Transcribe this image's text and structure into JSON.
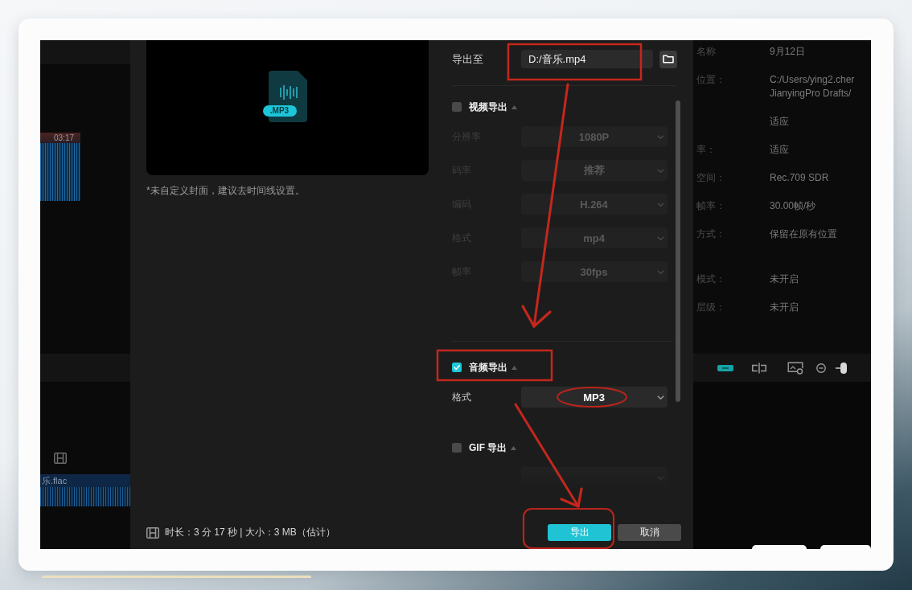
{
  "left_panel": {
    "waveform_time": "03:17",
    "track_clip": {
      "name": "乐.flac"
    }
  },
  "export_dialog": {
    "preview": {
      "file_badge": ".MP3"
    },
    "cover_note": "*未自定义封面，建议去时间线设置。",
    "export_to": {
      "label": "导出至",
      "value": "D:/音乐.mp4"
    },
    "sections": [
      {
        "title": "视频导出",
        "checked": false,
        "settings": [
          {
            "kind": "dropdown",
            "label": "分辨率",
            "value": "1080P"
          },
          {
            "kind": "dropdown",
            "label": "码率",
            "value": "推荐"
          },
          {
            "kind": "dropdown",
            "label": "编码",
            "value": "H.264"
          },
          {
            "kind": "dropdown",
            "label": "格式",
            "value": "mp4"
          },
          {
            "kind": "dropdown",
            "label": "帧率",
            "value": "30fps"
          }
        ]
      },
      {
        "title": "音频导出",
        "checked": true,
        "settings": [
          {
            "kind": "dropdown",
            "label": "格式",
            "value": "MP3"
          }
        ]
      },
      {
        "title": "GIF 导出",
        "checked": false,
        "settings": [
          {
            "kind": "dropdown"
          }
        ]
      }
    ],
    "footer": {
      "summary": "时长：3 分 17 秒 | 大小：3 MB（估计）",
      "buttons": [
        {
          "label": "导出",
          "kind": "primary"
        },
        {
          "label": "取消",
          "kind": "secondary"
        }
      ]
    }
  },
  "draft_info": {
    "groups": [
      {
        "rows": [
          {
            "label": "名称",
            "lines": [
              "9月12日"
            ]
          },
          {
            "label": "位置：",
            "lines": [
              "C:/Users/ying2.cher",
              "JianyingPro Drafts/"
            ]
          },
          {
            "lines": [
              "适应"
            ]
          },
          {
            "label": "率：",
            "lines": [
              "适应"
            ]
          },
          {
            "label": "空间：",
            "lines": [
              "Rec.709 SDR"
            ]
          },
          {
            "label": "帧率：",
            "lines": [
              "30.00帧/秒"
            ]
          },
          {
            "label": "方式：",
            "lines": [
              "保留在原有位置"
            ]
          }
        ]
      },
      {
        "rows": [
          {
            "label": "模式：",
            "lines": [
              "未开启"
            ]
          },
          {
            "label": "层级：",
            "lines": [
              "未开启"
            ]
          }
        ]
      }
    ]
  },
  "annotations": [
    {
      "kind": "rectangle"
    },
    {
      "kind": "arrow"
    },
    {
      "kind": "rectangle"
    },
    {
      "kind": "ellipse"
    },
    {
      "kind": "arrow"
    },
    {
      "kind": "rounded_rectangle"
    }
  ]
}
